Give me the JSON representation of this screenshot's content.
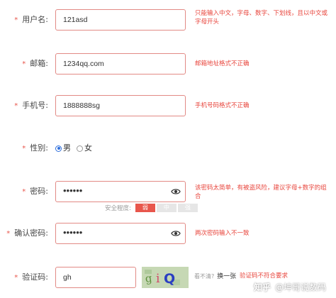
{
  "form": {
    "required_mark": "*",
    "username": {
      "label": "用户名:",
      "value": "121asd",
      "error": "只能输入中文，字母、数字、下划线，且以中文或字母开头"
    },
    "email": {
      "label": "邮箱:",
      "value": "1234qq.com",
      "error": "邮箱地址格式不正确"
    },
    "phone": {
      "label": "手机号:",
      "value": "1888888sg",
      "error": "手机号码格式不正确"
    },
    "gender": {
      "label": "性别:",
      "options": [
        {
          "label": "男",
          "selected": true
        },
        {
          "label": "女",
          "selected": false
        }
      ]
    },
    "password": {
      "label": "密码:",
      "value": "••••••",
      "error": "该密码太简单，有被盗风险，建议字母+数字的组合",
      "strength_label": "安全程度:",
      "strength_levels": [
        "弱",
        "中",
        "强"
      ],
      "strength_active": "弱"
    },
    "confirm_password": {
      "label": "确认密码:",
      "value": "••••••",
      "error": "两次密码输入不一致"
    },
    "captcha": {
      "label": "验证码:",
      "value": "gh",
      "image_text": "giQ",
      "hint": "看不清?",
      "refresh_label": "换一张",
      "error": "验证码不符合要求"
    }
  },
  "watermark": {
    "logo": "知乎",
    "text": "@坤哥说数码"
  },
  "colors": {
    "error": "#e8453c",
    "border": "#e28a85",
    "radio_selected": "#2f6fdc",
    "strength_weak": "#e8564c"
  }
}
